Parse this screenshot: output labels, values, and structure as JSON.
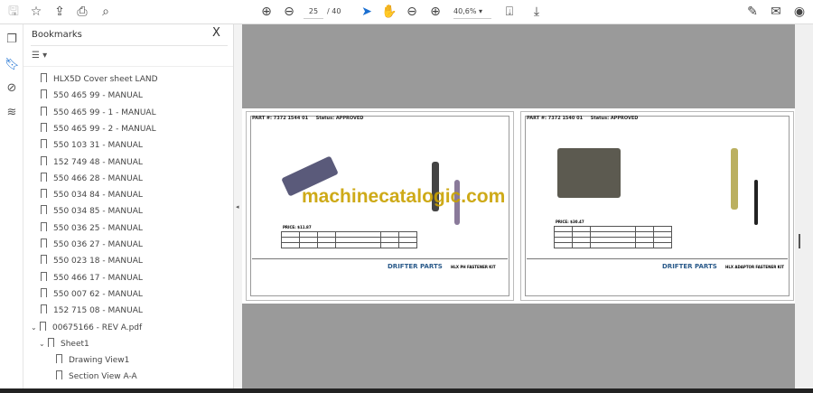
{
  "toolbar": {
    "page_current": "25",
    "page_total": "/ 40",
    "zoom": "40,6%"
  },
  "panel": {
    "title": "Bookmarks",
    "close": "X"
  },
  "bookmarks": [
    {
      "label": "HLX5D Cover sheet LAND"
    },
    {
      "label": "550 465 99 - MANUAL"
    },
    {
      "label": "550 465 99 - 1 - MANUAL"
    },
    {
      "label": "550 465 99 - 2 - MANUAL"
    },
    {
      "label": "550 103 31 - MANUAL"
    },
    {
      "label": "152 749 48 - MANUAL"
    },
    {
      "label": "550 466 28 - MANUAL"
    },
    {
      "label": "550 034 84 - MANUAL"
    },
    {
      "label": "550 034 85 - MANUAL"
    },
    {
      "label": "550 036 25 - MANUAL"
    },
    {
      "label": "550 036 27 - MANUAL"
    },
    {
      "label": "550 023 18 - MANUAL"
    },
    {
      "label": "550 466 17 - MANUAL"
    },
    {
      "label": "550 007 62 - MANUAL"
    },
    {
      "label": "152 715 08 - MANUAL"
    },
    {
      "label": "00675166 - REV A.pdf"
    },
    {
      "label": "Sheet1"
    },
    {
      "label": "Drawing View1"
    },
    {
      "label": "Section View A-A"
    }
  ],
  "pages": [
    {
      "part": "PART #: 7372 1544 01",
      "status": "Status: APPROVED",
      "price": "PRICE: $11.87",
      "title": "HLX PH FASTENER KIT",
      "company": "DRIFTER PARTS"
    },
    {
      "part": "PART #: 7372 1540 01",
      "status": "Status: APPROVED",
      "price": "PRICE: $30.47",
      "title": "HLX ADAPTOR FASTENER KIT",
      "company": "DRIFTER PARTS"
    }
  ],
  "watermark": "machinecatalogic.com"
}
